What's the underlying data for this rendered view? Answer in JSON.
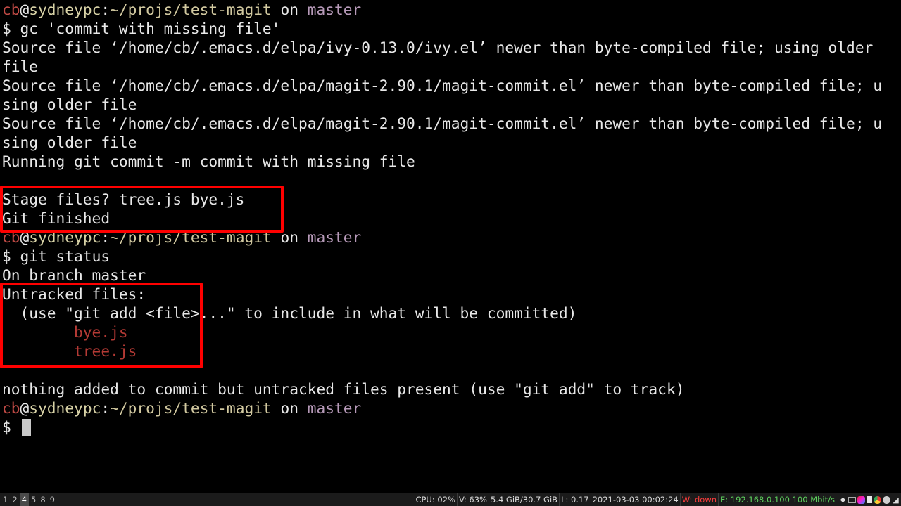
{
  "prompt": {
    "user": "cb",
    "at": "@",
    "host": "sydneypc",
    "colon": ":",
    "path": "~/projs/test-magit",
    "on": " on ",
    "branch": "master",
    "dollar": "$ "
  },
  "lines": {
    "cmd1": "gc 'commit with missing file'",
    "o1": "Source file ‘/home/cb/.emacs.d/elpa/ivy-0.13.0/ivy.el’ newer than byte-compiled file; using older",
    "o2": "file",
    "o3": "Source file ‘/home/cb/.emacs.d/elpa/magit-2.90.1/magit-commit.el’ newer than byte-compiled file; u",
    "o4": "sing older file",
    "o5": "Source file ‘/home/cb/.emacs.d/elpa/magit-2.90.1/magit-commit.el’ newer than byte-compiled file; u",
    "o6": "sing older file",
    "o7": "Running git commit -m commit with missing file",
    "o9": "Stage files? tree.js bye.js",
    "o10": "Git finished",
    "cmd2": "git status",
    "s1": "On branch master",
    "s2": "Untracked files:",
    "s3": "  (use \"git add <file>...\" to include in what will be committed)",
    "f1": "        bye.js",
    "f2": "        tree.js",
    "s5": "nothing added to commit but untracked files present (use \"git add\" to track)"
  },
  "statusbar": {
    "workspaces": [
      "1",
      "2",
      "4",
      "5",
      "8",
      "9"
    ],
    "active_workspace": "4",
    "cpu": "CPU: 02%",
    "volume": "V: 63%",
    "mem": "5.4 GiB/30.7 GiB",
    "load": "L: 0.17",
    "datetime": "2021-03-03 00:02:24",
    "wifi_label": "W:",
    "wifi_status": "down",
    "eth": "E: 192.168.0.100 100 Mbit/s",
    "tray_icons": [
      "dropbox-icon",
      "keyboard-icon",
      "color-picker-icon",
      "document-icon",
      "chrome-icon",
      "steam-icon",
      "network-icon"
    ]
  },
  "colors": {
    "highlight_box": "#ff0000",
    "untracked_file": "#b53a35",
    "prompt_user": "#c04a45",
    "prompt_branch": "#b79ab9"
  }
}
